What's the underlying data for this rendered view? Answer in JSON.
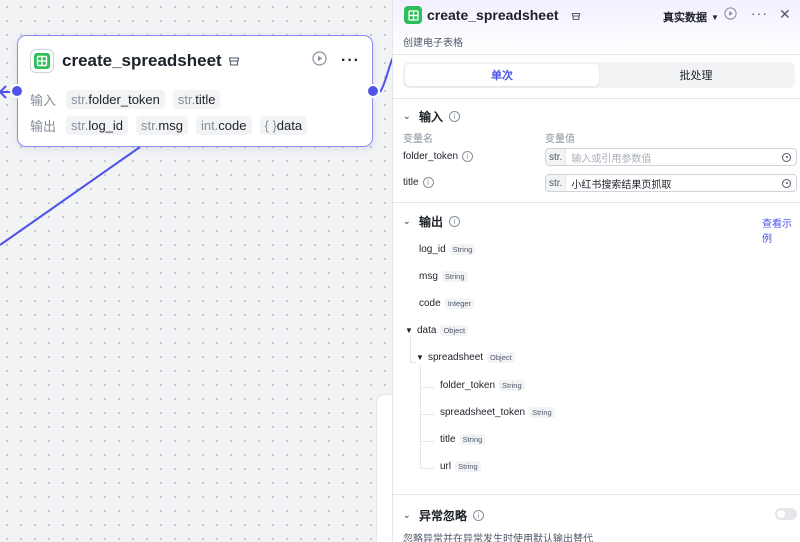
{
  "node": {
    "title": "create_spreadsheet",
    "input_label": "输入",
    "output_label": "输出",
    "inputs": [
      {
        "type": "str.",
        "name": "folder_token"
      },
      {
        "type": "str.",
        "name": "title"
      }
    ],
    "outputs": [
      {
        "type": "str.",
        "name": "log_id"
      },
      {
        "type": "str.",
        "name": "msg"
      },
      {
        "type": "int.",
        "name": "code"
      },
      {
        "type": "{ }",
        "name": "data"
      }
    ]
  },
  "panel": {
    "title": "create_spreadsheet",
    "subtitle": "创建电子表格",
    "mode": "真实数据",
    "more": "···",
    "close": "✕",
    "tabs": [
      {
        "label": "单次",
        "active": true
      },
      {
        "label": "批处理",
        "active": false
      }
    ],
    "input_section": {
      "title": "输入",
      "col_name": "变量名",
      "col_value": "变量值",
      "fields": [
        {
          "name": "folder_token",
          "type": "str.",
          "value": "",
          "placeholder": "输入或引用参数值"
        },
        {
          "name": "title",
          "type": "str.",
          "value": "小红书搜索结果页抓取",
          "placeholder": ""
        }
      ]
    },
    "output_section": {
      "title": "输出",
      "example_link": "查看示例",
      "items": [
        {
          "name": "log_id",
          "type": "String"
        },
        {
          "name": "msg",
          "type": "String"
        },
        {
          "name": "code",
          "type": "Integer"
        },
        {
          "name": "data",
          "type": "Object"
        },
        {
          "name": "spreadsheet",
          "type": "Object"
        },
        {
          "name": "folder_token",
          "type": "String"
        },
        {
          "name": "spreadsheet_token",
          "type": "String"
        },
        {
          "name": "title",
          "type": "String"
        },
        {
          "name": "url",
          "type": "String"
        }
      ]
    },
    "error_section": {
      "title": "异常忽略",
      "description": "忽略异常并在异常发生时使用默认输出替代",
      "enabled": false
    }
  },
  "colors": {
    "accent": "#4d53e8",
    "node_border": "#8b8cf6",
    "sheet_icon": "#2fbf5a"
  }
}
